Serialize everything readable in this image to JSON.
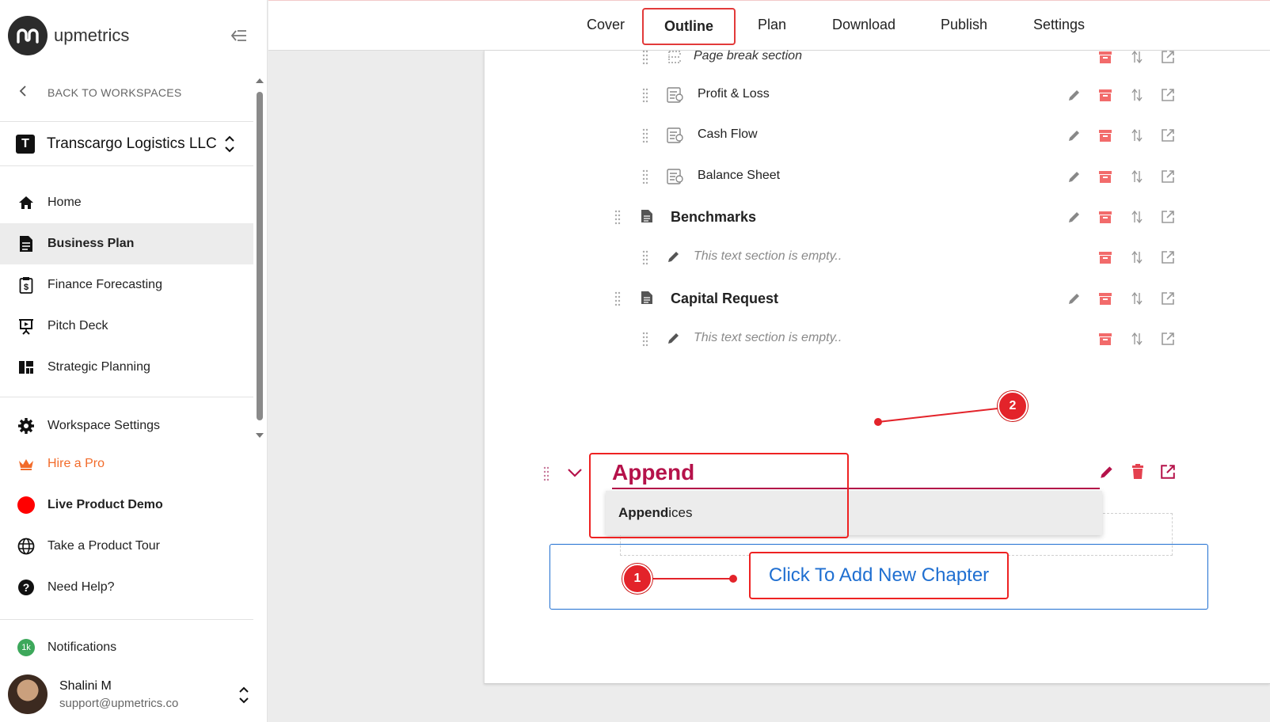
{
  "app": {
    "name": "upmetrics"
  },
  "sidebar": {
    "back_label": "BACK TO WORKSPACES",
    "workspace": {
      "badge": "T",
      "name": "Transcargo Logistics LLC"
    },
    "nav": [
      {
        "label": "Home",
        "icon": "home-icon"
      },
      {
        "label": "Business Plan",
        "icon": "document-icon",
        "active": true
      },
      {
        "label": "Finance Forecasting",
        "icon": "finance-clipboard-icon"
      },
      {
        "label": "Pitch Deck",
        "icon": "presentation-icon"
      },
      {
        "label": "Strategic Planning",
        "icon": "dashboard-icon"
      }
    ],
    "secondary": [
      {
        "label": "Workspace Settings",
        "icon": "gear-icon"
      },
      {
        "label": "Hire a Pro",
        "icon": "crown-icon",
        "color": "#f26b2a"
      },
      {
        "label": "Live Product Demo",
        "icon": "red-dot-icon"
      },
      {
        "label": "Take a Product Tour",
        "icon": "globe-icon"
      },
      {
        "label": "Need Help?",
        "icon": "help-icon"
      }
    ],
    "notifications": {
      "label": "Notifications",
      "badge": "1k"
    },
    "user": {
      "name": "Shalini M",
      "email": "support@upmetrics.co"
    }
  },
  "tabs": [
    "Cover",
    "Outline",
    "Plan",
    "Download",
    "Publish",
    "Settings"
  ],
  "active_tab": "Outline",
  "outline": {
    "rows": [
      {
        "label": "Page break section",
        "kind": "page-break"
      },
      {
        "label": "Profit & Loss",
        "kind": "financial"
      },
      {
        "label": "Cash Flow",
        "kind": "financial"
      },
      {
        "label": "Balance Sheet",
        "kind": "financial"
      },
      {
        "label": "Benchmarks",
        "kind": "chapter"
      },
      {
        "label": "This text section is empty..",
        "kind": "empty-text"
      },
      {
        "label": "Capital Request",
        "kind": "chapter"
      },
      {
        "label": "This text section is empty..",
        "kind": "empty-text"
      }
    ],
    "new_chapter": {
      "input_value": "Append",
      "suggestion_match": "Append",
      "suggestion_rest": "ices"
    },
    "add_chapter_label": "Click To Add New Chapter"
  },
  "annotations": {
    "step1": "1",
    "step2": "2"
  },
  "colors": {
    "accent": "#b5124a",
    "delete": "#f26b6b",
    "link": "#1f6fd1",
    "annotation": "#e3232a"
  }
}
